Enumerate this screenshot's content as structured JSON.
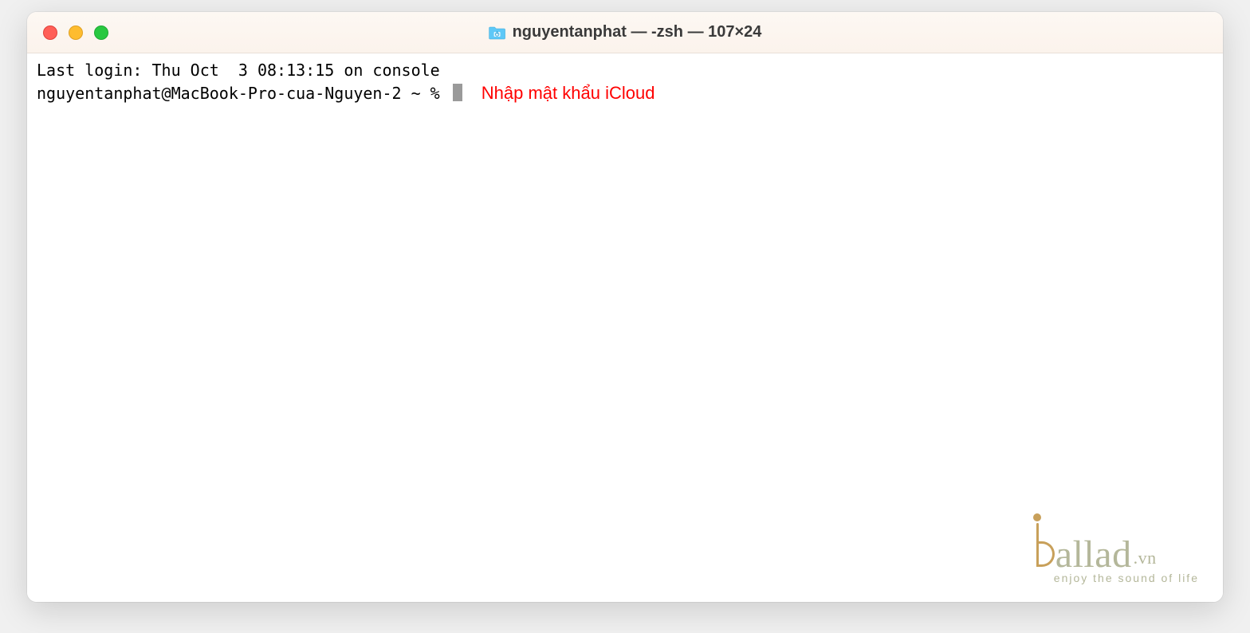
{
  "window": {
    "title": "nguyentanphat — -zsh — 107×24"
  },
  "terminal": {
    "last_login": "Last login: Thu Oct  3 08:13:15 on console",
    "prompt": "nguyentanphat@MacBook-Pro-cua-Nguyen-2 ~ % "
  },
  "annotation": {
    "text": "Nhập mật khẩu iCloud",
    "color": "#ff0000"
  },
  "watermark": {
    "brand": "allad",
    "tld": ".vn",
    "tagline": "enjoy the sound of life"
  }
}
